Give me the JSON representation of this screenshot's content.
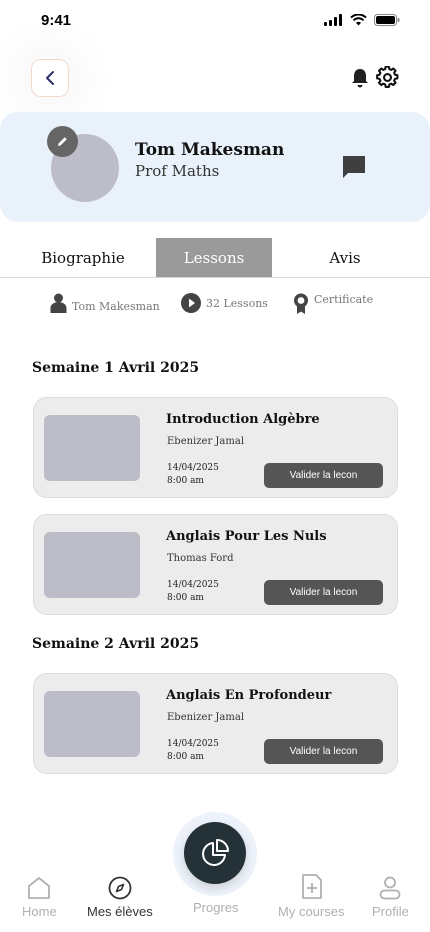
{
  "status_bar": {
    "time": "9:41"
  },
  "profile": {
    "name": "Tom Makesman",
    "role": "Prof Maths"
  },
  "tabs": [
    {
      "label": "Biographie",
      "active": false
    },
    {
      "label": "Lessons",
      "active": true
    },
    {
      "label": "Avis",
      "active": false
    }
  ],
  "meta": {
    "teacher": "Tom Makesman",
    "lessons_count": "32 Lessons",
    "certificate": "Certificate"
  },
  "sections": [
    {
      "title": "Semaine 1 Avril 2025",
      "lessons": [
        {
          "title": "Introduction Algèbre",
          "teacher": "Ebenizer Jamal",
          "date": "14/04/2025",
          "time": "8:00 am",
          "button": "Valider la lecon"
        },
        {
          "title": "Anglais Pour Les Nuls",
          "teacher": "Thomas Ford",
          "date": "14/04/2025",
          "time": "8:00 am",
          "button": "Valider la lecon"
        }
      ]
    },
    {
      "title": "Semaine 2 Avril 2025",
      "lessons": [
        {
          "title": "Anglais En Profondeur",
          "teacher": "Ebenizer Jamal",
          "date": "14/04/2025",
          "time": "8:00 am",
          "button": "Valider la lecon"
        }
      ]
    }
  ],
  "bottom_nav": [
    {
      "label": "Home",
      "icon": "home-icon",
      "active": false
    },
    {
      "label": "Mes élèves",
      "icon": "compass-icon",
      "active": true
    },
    {
      "label": "Progres",
      "icon": "pie-chart-icon",
      "active": false
    },
    {
      "label": "My courses",
      "icon": "add-course-icon",
      "active": false
    },
    {
      "label": "Profile",
      "icon": "user-icon",
      "active": false
    }
  ],
  "colors": {
    "profile_card_bg": "#e9f1fb",
    "active_tab_bg": "#9a9a9a",
    "button_bg": "#555555",
    "fab_bg": "#243237"
  }
}
